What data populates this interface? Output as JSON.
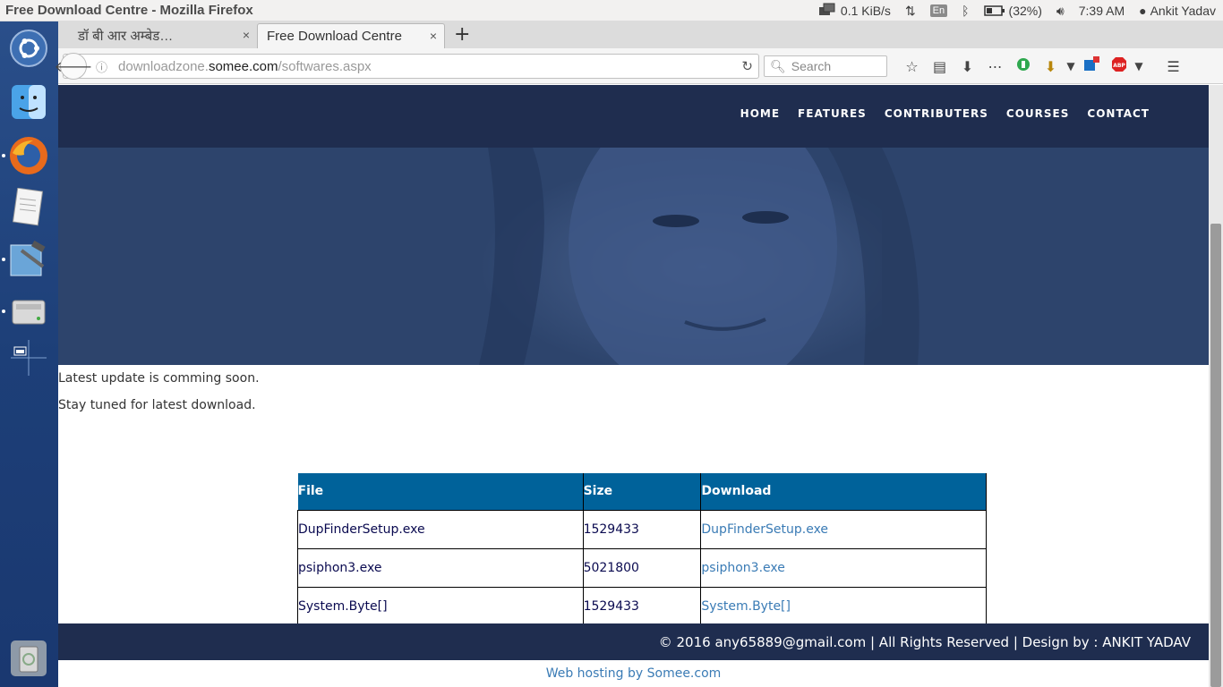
{
  "window": {
    "title": "Free Download Centre - Mozilla Firefox"
  },
  "indicators": {
    "network_speed": "0.1 KiB/s",
    "keyboard_layout": "En",
    "battery": "(32%)",
    "time": "7:39 AM",
    "user": "Ankit Yadav"
  },
  "launcher": {
    "items": [
      "ubuntu-dash-icon",
      "finder-icon",
      "firefox-icon",
      "text-editor-icon",
      "xcode-icon",
      "disk-icon",
      "workspaces-icon",
      "trash-icon"
    ]
  },
  "tabs": [
    {
      "label": "डॉ बी आर अम्बेड…",
      "close": "×"
    },
    {
      "label": "Free Download Centre",
      "close": "×"
    }
  ],
  "newtab_label": "+",
  "url": {
    "prefix": "downloadzone.",
    "domain": "somee.com",
    "path": "/softwares.aspx"
  },
  "search": {
    "placeholder": "Search"
  },
  "site_nav": [
    "HOME",
    "FEATURES",
    "CONTRIBUTERS",
    "COURSES",
    "CONTACT"
  ],
  "messages": {
    "line1": "Latest update is comming soon.",
    "line2": "Stay tuned for latest download."
  },
  "table": {
    "headers": [
      "File",
      "Size",
      "Download"
    ],
    "rows": [
      [
        "DupFinderSetup.exe",
        "1529433",
        "DupFinderSetup.exe"
      ],
      [
        "psiphon3.exe",
        "5021800",
        "psiphon3.exe"
      ],
      [
        "System.Byte[]",
        "1529433",
        "System.Byte[]"
      ]
    ]
  },
  "footer": "© 2016 any65889@gmail.com | All Rights Reserved | Design by : ANKIT YADAV",
  "hosting": "Web hosting by Somee.com",
  "colors": {
    "site_nav_bg": "#1f2d4f",
    "table_header_bg": "#00629a",
    "link": "#3a7bb5",
    "launcher_bg": "#1d3f78"
  }
}
